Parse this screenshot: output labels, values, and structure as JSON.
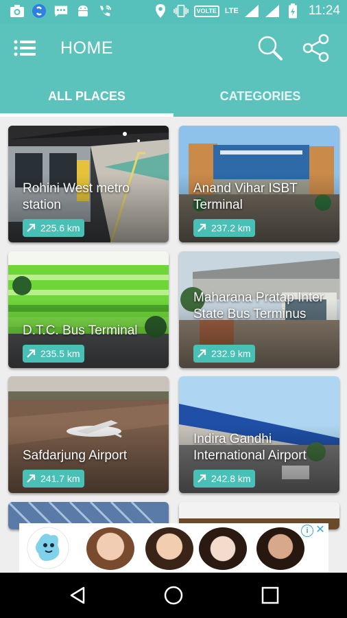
{
  "status_bar": {
    "time": "11:24",
    "network": "LTE",
    "volte": "VOLTE",
    "icons": [
      "camera-icon",
      "shazam-icon",
      "chat-icon",
      "android-icon",
      "wifi-calling-icon",
      "location-icon",
      "vibrate-icon",
      "volte-icon",
      "signal-icon",
      "signal-icon",
      "battery-charging-icon"
    ]
  },
  "app_bar": {
    "title": "HOME",
    "tabs": [
      "ALL PLACES",
      "CATEGORIES"
    ],
    "selected_tab": "ALL PLACES",
    "accent": "#5cc3bc"
  },
  "places": [
    {
      "name": "Rohini West metro station",
      "distance": "225.6 km"
    },
    {
      "name": "Anand Vihar ISBT Terminal",
      "distance": "237.2 km"
    },
    {
      "name": "D.T.C. Bus Terminal",
      "distance": "235.5 km"
    },
    {
      "name": "Maharana Pratap Inter State Bus Terminus",
      "distance": "232.9 km"
    },
    {
      "name": "Safdarjung Airport",
      "distance": "241.7 km"
    },
    {
      "name": "Indira Gandhi International Airport",
      "distance": "242.8 km"
    }
  ],
  "ad": {
    "info_label": "i",
    "close_label": "✕"
  },
  "nav": [
    "back-icon",
    "home-icon",
    "recents-icon"
  ]
}
